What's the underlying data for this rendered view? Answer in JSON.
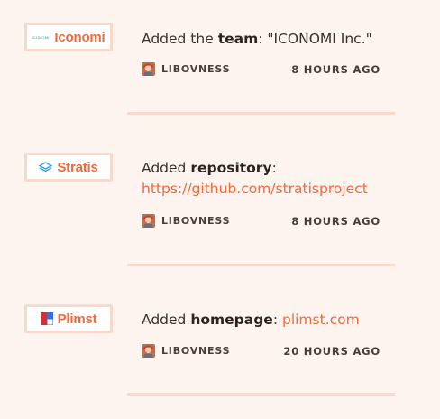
{
  "colors": {
    "background": "#fdf3ef",
    "accent": "#ee6b3c",
    "badge_border": "#f8d9cc",
    "divider": "#f8d9cc"
  },
  "feed": [
    {
      "badge": {
        "label": "Iconomi",
        "logo_text": "ICONOMI",
        "icon": "iconomi-logo-icon"
      },
      "text_prefix": "Added the ",
      "field": "team",
      "separator": ": ",
      "value": "\"ICONOMI Inc.\"",
      "user": "LIBOVNESS",
      "avatar": "user-avatar",
      "time": "8 HOURS AGO"
    },
    {
      "badge": {
        "label": "Stratis",
        "icon": "stratis-logo-icon"
      },
      "text_prefix": "Added ",
      "field": "repository",
      "separator": ":",
      "link": "https://github.com/stratisproject",
      "user": "LIBOVNESS",
      "avatar": "user-avatar",
      "time": "8 HOURS AGO"
    },
    {
      "badge": {
        "label": "Plimst",
        "icon": "plimst-logo-icon"
      },
      "text_prefix": "Added ",
      "field": "homepage",
      "separator": ": ",
      "link": "plimst.com",
      "user": "LIBOVNESS",
      "avatar": "user-avatar",
      "time": "20 HOURS AGO"
    }
  ]
}
